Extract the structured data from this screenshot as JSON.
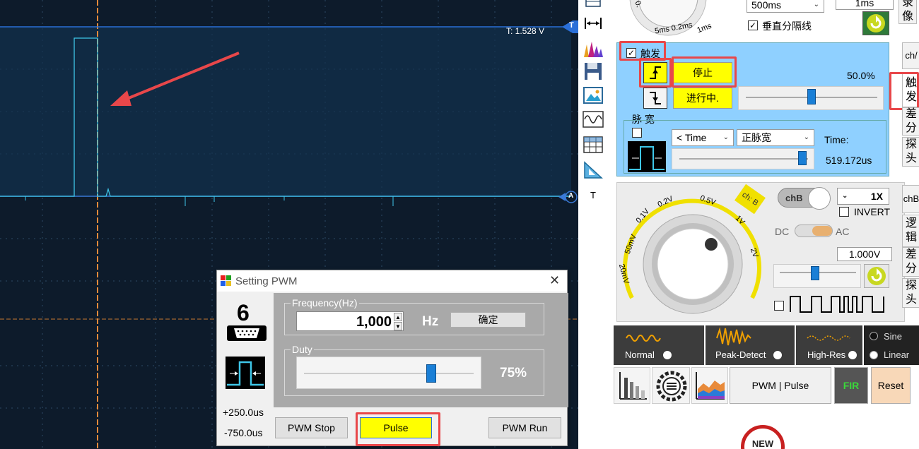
{
  "scope": {
    "trigger_level_label": "T: 1.528 V",
    "trigger_marker": "T",
    "channel_marker": "A"
  },
  "tools": {
    "items": [
      "cursor-icon",
      "measure-icon",
      "spectrum-icon",
      "save-icon",
      "image-icon",
      "wave-icon",
      "grid-icon",
      "ruler-icon"
    ],
    "text_tool": "T"
  },
  "timebase": {
    "select_value": "500ms",
    "box_value": "1ms",
    "knob_label_0": "0.",
    "knob_label_1": "5ms 0.2ms",
    "knob_label_2": "1ms",
    "vertical_sep_label": "垂直分隔线",
    "record_tab": "录\n像"
  },
  "trigger": {
    "enable_label": "触发",
    "stop_label": "停止",
    "running_label": "进行中.",
    "percent": "50.0%",
    "pulse_width_label": "脉 宽",
    "time_select": "< Time",
    "polarity_select": "正脉宽",
    "time_label": "Time:",
    "time_value": "519.172us",
    "position_fraction": 0.5
  },
  "side_tabs": {
    "ch_a": "ch/",
    "trigger": "触\n发",
    "diff": "差\n分",
    "probe": "探\n头",
    "ch_b": "chB",
    "logic": "逻\n辑",
    "diff2": "差\n分",
    "probe2": "探\n头"
  },
  "channel_b": {
    "toggle_label": "chB",
    "probe_select": "1X",
    "invert_label": "INVERT",
    "dc_label": "DC",
    "ac_label": "AC",
    "volt_box": "1.000V",
    "knob_tag": "ch: B",
    "scale_labels": [
      "20mV",
      "50mV",
      "0.1V",
      "0.2V",
      "0.5V",
      "1V",
      "2V"
    ]
  },
  "modes": {
    "normal": "Normal",
    "peak": "Peak-Detect",
    "highres": "High-Res",
    "sine": "Sine",
    "linear": "Linear"
  },
  "toolbar": {
    "pwm_pulse": "PWM | Pulse",
    "fir": "FIR",
    "reset": "Reset",
    "new_badge": "NEW"
  },
  "dialog": {
    "title": "Setting PWM",
    "channel_number": "6",
    "plus_time": "+250.0us",
    "minus_time": "-750.0us",
    "freq_group": "Frequency(Hz)",
    "freq_value": "1,000",
    "freq_unit": "Hz",
    "confirm": "确定",
    "duty_group": "Duty",
    "duty_value": "75%",
    "duty_fraction": 0.75,
    "pwm_stop": "PWM Stop",
    "pulse": "Pulse",
    "pwm_run": "PWM Run"
  },
  "colors": {
    "scope_bg": "#0d1b2b",
    "trace": "#3ec6e8",
    "highlight": "#e8474a",
    "yellow": "#ffff00",
    "accent_blue": "#1a7fd6"
  }
}
